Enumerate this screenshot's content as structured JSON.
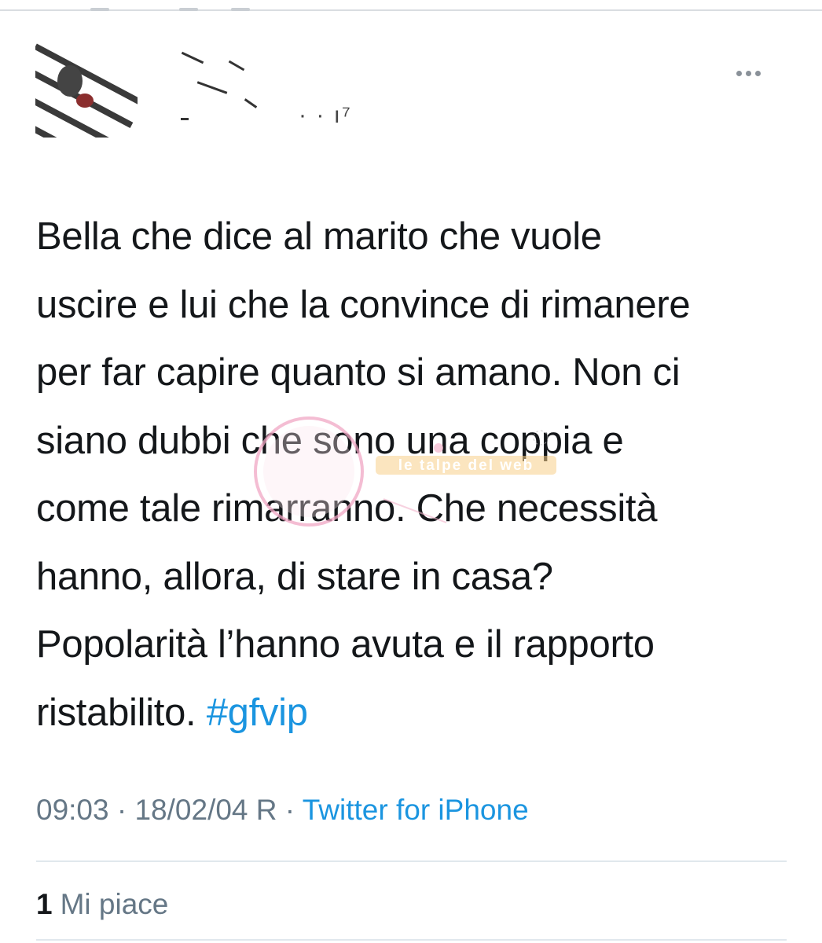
{
  "tweet": {
    "lines": [
      "Bella che dice al marito che vuole",
      "uscire e lui che la convince di rimanere",
      "per far capire quanto si amano. Non ci",
      "siano dubbi che sono una coppia e",
      "come tale rimarranno. Che necessità",
      "hanno, allora, di stare in casa?",
      "Popolarità l’hanno avuta e il rapporto",
      "ristabilito."
    ],
    "hashtag": "#gfvip"
  },
  "meta": {
    "time": "09:03",
    "separator": " · ",
    "date": "18/02/04 R",
    "source": "Twitter for iPhone"
  },
  "stats": {
    "like_count": "1",
    "like_label": "Mi piace"
  },
  "watermark": {
    "text": "le talpe del web"
  },
  "colors": {
    "link": "#1b95e0",
    "meta": "#657786",
    "text": "#14171a",
    "divider": "#e1e8ed"
  }
}
